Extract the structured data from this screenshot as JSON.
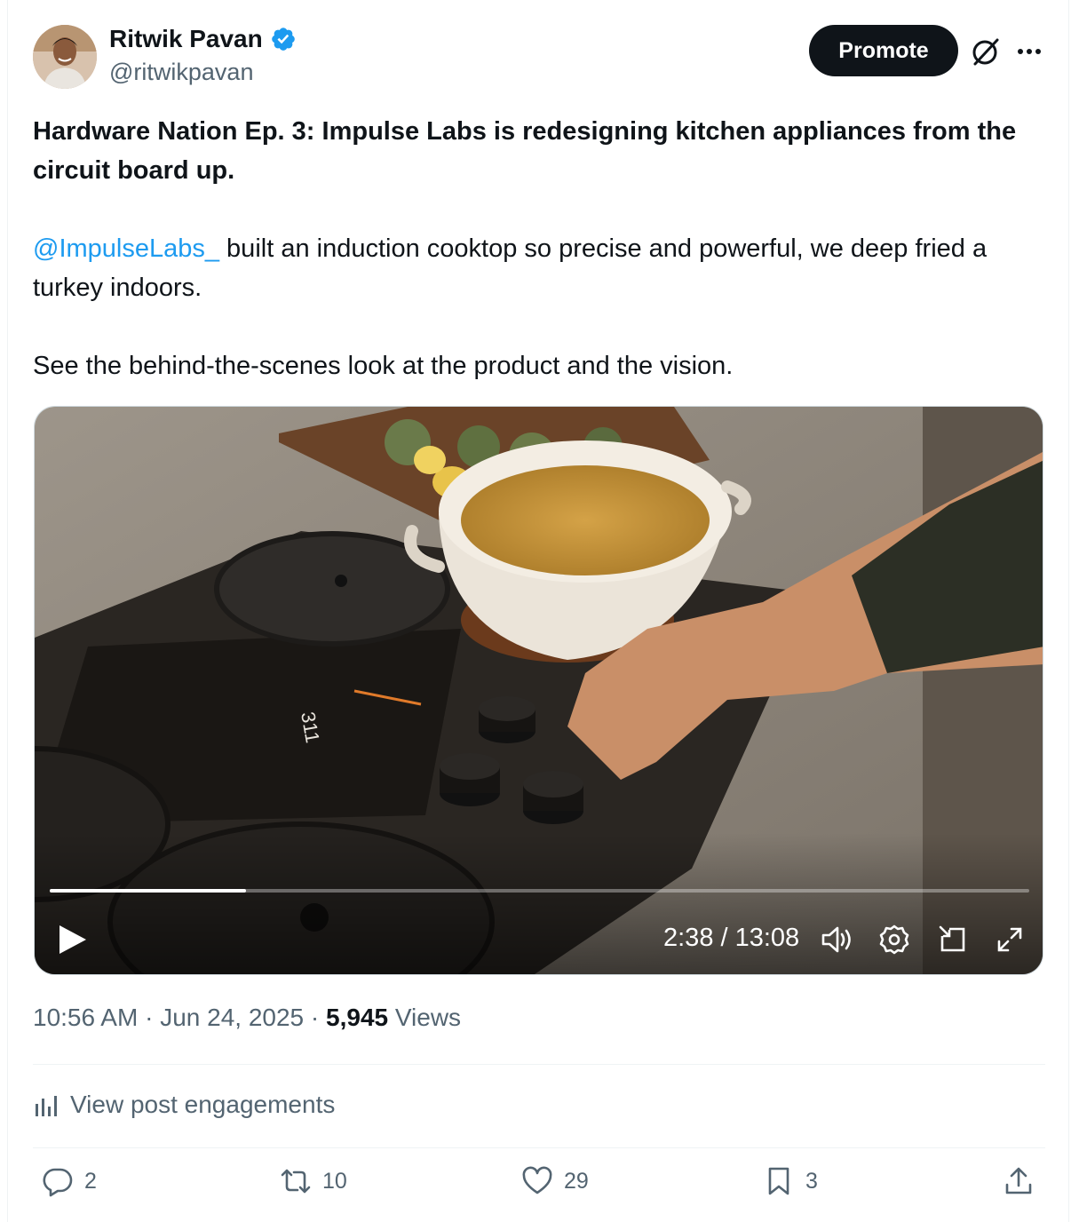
{
  "author": {
    "name": "Ritwik Pavan",
    "handle": "@ritwikpavan",
    "verified": true
  },
  "header": {
    "promote_label": "Promote",
    "icons": [
      "grok-icon",
      "more-icon"
    ]
  },
  "post": {
    "headline": "Hardware Nation Ep. 3: Impulse Labs is redesigning kitchen appliances from the circuit board up.",
    "mention": "@ImpulseLabs_",
    "para2_rest": " built an induction cooktop so precise and powerful, we deep fried a turkey indoors.",
    "para3": "See the behind-the-scenes look at the product and the vision."
  },
  "video": {
    "time": "2:38 / 13:08",
    "progress_fraction": 0.2,
    "controls": [
      "play-icon",
      "volume-icon",
      "settings-icon",
      "pip-icon",
      "fullscreen-icon"
    ]
  },
  "meta": {
    "time": "10:56 AM",
    "date": "Jun 24, 2025",
    "views_count": "5,945",
    "views_label": "Views"
  },
  "engagements_label": "View post engagements",
  "actions": {
    "replies": "2",
    "reposts": "10",
    "likes": "29",
    "bookmarks": "3"
  },
  "colors": {
    "accent": "#1d9bf0",
    "text": "#0f1419",
    "secondary": "#536471"
  }
}
